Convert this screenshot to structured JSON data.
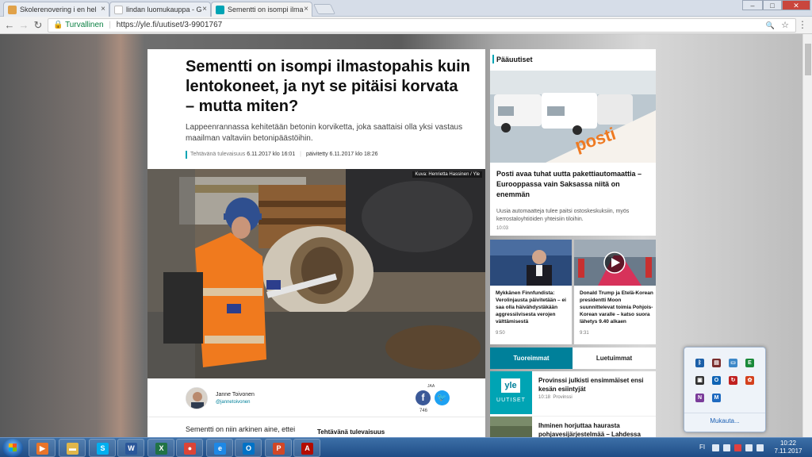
{
  "browser": {
    "tabs": [
      {
        "title": "Skolerenovering i en hel",
        "active": false
      },
      {
        "title": "lindan luomukauppa - G",
        "active": false
      },
      {
        "title": "Sementti on isompi ilma",
        "active": true
      }
    ],
    "close_glyph": "×",
    "secure_label": "Turvallinen",
    "url_host": "https://yle.fi",
    "url_path": "/uutiset/3-9901767",
    "nav_back": "←",
    "nav_forward": "→",
    "nav_reload": "↻",
    "menu_glyph": "⋮",
    "zoom_glyph": "🔍",
    "star_glyph": "☆",
    "win_min": "–",
    "win_max": "□",
    "win_close": "✕"
  },
  "article": {
    "title": "Sementti on isompi ilmastopahis kuin lentokoneet, ja nyt se pitäisi korvata – mutta miten?",
    "lead": "Lappeenrannassa kehitetään betonin korviketta, joka saattaisi olla yksi vastaus maailman valtaviin betonipäästöihin.",
    "category": "Tehtävänä tulevaisuus",
    "published": "6.11.2017 klo 16:01",
    "updated": "päivitetty 6.11.2017 klo 18:26",
    "meta_sep": "|",
    "photo_credit": "Kuva: Henrietta Hassinen / Yle",
    "author_name": "Janne Toivonen",
    "author_handle": "@jannetoivonen",
    "share_label": "JAA",
    "share_count": "746",
    "fb_glyph": "f",
    "tw_glyph": "🐦",
    "body_start": "Sementti on niin arkinen aine, ettei",
    "subhead": "Tehtävänä tulevaisuus"
  },
  "sidebar": {
    "heading": "Pääuutiset",
    "main_story": {
      "title": "Posti avaa tuhat uutta pakettiautomaattia – Eurooppassa vain Saksassa niitä on enemmän",
      "desc": "Uusia automaatteja tulee paitsi ostoskeskuksiin, myös kerrostaloyhtiöiden yhteisiin tiloihin.",
      "time": "10:03",
      "sign_text": "posti"
    },
    "small_stories": [
      {
        "title": "Mykkänen Finnfundista: Verolinjausta päivitetään – ei saa olla häivähdystäkään aggressiivisesta verojen välttämisestä",
        "time": "9:50"
      },
      {
        "title": "Donald Trump ja Etelä-Korean presidentti Moon suunnittelevat toimia Pohjois-Korean varalle – katso suora lähetys 9.40 alkaen",
        "time": "9:31"
      }
    ],
    "tab_latest": "Tuoreimmat",
    "tab_most_read": "Luetuimmat",
    "latest": [
      {
        "title": "Provinssi julkisti ensimmäiset ensi kesän esiintyjät",
        "time": "10:18",
        "source": "Provinssi",
        "logo": "yle",
        "logo_sub": "UUTISET"
      },
      {
        "title": "Ihminen horjuttaa haurasta pohjavesijärjestelmää – Lahdessa",
        "time": ""
      }
    ]
  },
  "tray_popup": {
    "customize_label": "Mukauta...",
    "icons": [
      {
        "name": "bluetooth-icon",
        "color": "#1b5fa8",
        "glyph": "ᛒ"
      },
      {
        "name": "network-monitor-icon",
        "color": "#7a2d2d",
        "glyph": "▤"
      },
      {
        "name": "display-icon",
        "color": "#3d88c8",
        "glyph": "▭"
      },
      {
        "name": "evernote-icon",
        "color": "#1a8a3a",
        "glyph": "E"
      },
      {
        "name": "app-tray-icon",
        "color": "#333333",
        "glyph": "▣"
      },
      {
        "name": "outlook-tray-icon",
        "color": "#0f64b5",
        "glyph": "O"
      },
      {
        "name": "sync-red-icon",
        "color": "#c02020",
        "glyph": "↻"
      },
      {
        "name": "creative-cloud-icon",
        "color": "#d4411e",
        "glyph": "✿"
      },
      {
        "name": "onenote-tray-icon",
        "color": "#7a3c9a",
        "glyph": "N"
      },
      {
        "name": "maxthon-tray-icon",
        "color": "#1f6ac0",
        "glyph": "M"
      }
    ]
  },
  "taskbar": {
    "apps": [
      {
        "name": "media-player-icon",
        "color": "#e8742a",
        "glyph": "▶"
      },
      {
        "name": "file-explorer-icon",
        "color": "#e0b64a",
        "glyph": "▬"
      },
      {
        "name": "skype-icon",
        "color": "#00aff0",
        "glyph": "S"
      },
      {
        "name": "word-icon",
        "color": "#2b579a",
        "glyph": "W"
      },
      {
        "name": "excel-icon",
        "color": "#217346",
        "glyph": "X"
      },
      {
        "name": "chrome-icon",
        "color": "#db4437",
        "glyph": "●"
      },
      {
        "name": "internet-explorer-icon",
        "color": "#1e88e5",
        "glyph": "e"
      },
      {
        "name": "outlook-icon",
        "color": "#0072c6",
        "glyph": "O"
      },
      {
        "name": "powerpoint-icon",
        "color": "#d24726",
        "glyph": "P"
      },
      {
        "name": "acrobat-icon",
        "color": "#b30b00",
        "glyph": "A"
      }
    ],
    "language": "FI",
    "time": "10:22",
    "date": "7.11.2017"
  }
}
